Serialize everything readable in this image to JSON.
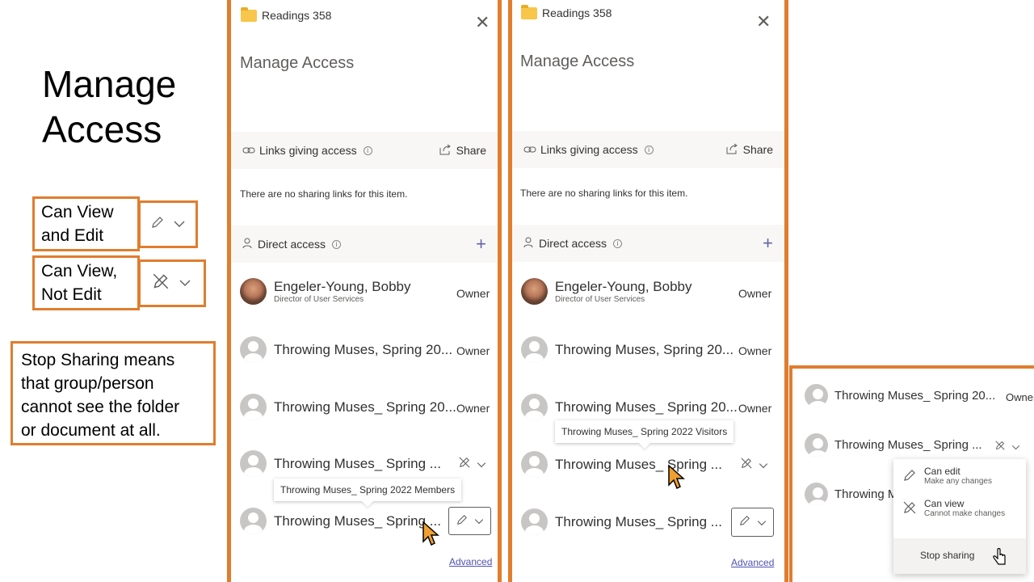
{
  "slide": {
    "title": "Manage\nAccess",
    "can_view_edit": "Can View\nand Edit",
    "can_view_not_edit": "Can View,\nNot Edit",
    "stop_sharing_note": "Stop Sharing means\nthat group/person\ncannot see the folder\nor document at all."
  },
  "panel1": {
    "folder": "Readings 358",
    "title": "Manage Access",
    "links_heading": "Links giving access",
    "share_label": "Share",
    "no_links": "There are no sharing links for this item.",
    "direct_heading": "Direct access",
    "people": [
      {
        "name": "Engeler-Young, Bobby",
        "subtitle": "Director of User Services",
        "role": "Owner"
      },
      {
        "name": "Throwing Muses, Spring 20...",
        "role": "Owner"
      },
      {
        "name": "Throwing Muses_ Spring 20...",
        "role": "Owner"
      },
      {
        "name": "Throwing Muses_ Spring ..."
      },
      {
        "name": "Throwing Muses_ Spring ..."
      }
    ],
    "tooltip": "Throwing Muses_ Spring 2022 Members",
    "advanced": "Advanced"
  },
  "panel2": {
    "folder": "Readings 358",
    "title": "Manage Access",
    "links_heading": "Links giving access",
    "share_label": "Share",
    "no_links": "There are no sharing links for this item.",
    "direct_heading": "Direct access",
    "people": [
      {
        "name": "Engeler-Young, Bobby",
        "subtitle": "Director of User Services",
        "role": "Owner"
      },
      {
        "name": "Throwing Muses, Spring 20...",
        "role": "Owner"
      },
      {
        "name": "Throwing Muses_ Spring 20...",
        "role": "Owner"
      },
      {
        "name": "Throwing Muses_ Spring ..."
      },
      {
        "name": "Throwing Muses_ Spring ..."
      }
    ],
    "tooltip": "Throwing Muses_ Spring 2022 Visitors",
    "advanced": "Advanced"
  },
  "panel3": {
    "people": [
      {
        "name": "Throwing Muses_ Spring 20...",
        "role": "Owner"
      },
      {
        "name": "Throwing Muses_ Spring ..."
      },
      {
        "name": "Throwing M"
      }
    ],
    "menu": {
      "edit_title": "Can edit",
      "edit_sub": "Make any changes",
      "view_title": "Can view",
      "view_sub": "Cannot make changes",
      "stop": "Stop sharing"
    }
  },
  "colors": {
    "accent_border": "#e07d2e",
    "link": "#4f52b2",
    "share_icon": "#6264a7"
  },
  "icons": [
    "folder-icon",
    "close-icon",
    "link-icon",
    "share-icon",
    "info-icon",
    "person-icon",
    "plus-icon",
    "pencil-icon",
    "no-edit-icon",
    "chevron-down-icon",
    "mouse-cursor-icon",
    "hand-cursor-icon"
  ]
}
